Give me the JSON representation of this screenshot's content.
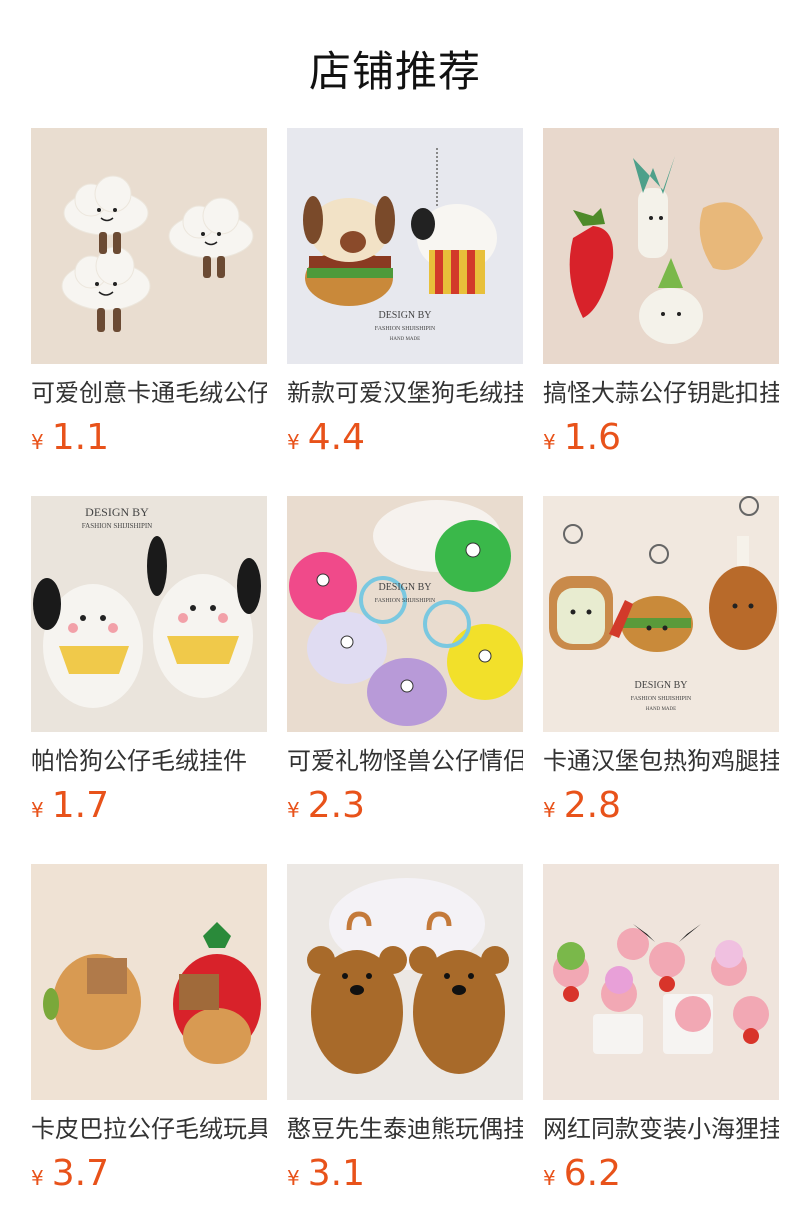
{
  "header": {
    "title": "店铺推荐"
  },
  "currency_symbol": "¥",
  "products": [
    {
      "name": "可爱创意卡通毛绒公仔",
      "price": "1.1",
      "image": "white-cloud-plush"
    },
    {
      "name": "新款可爱汉堡狗毛绒挂件",
      "price": "4.4",
      "image": "hamburger-dog-plush"
    },
    {
      "name": "搞怪大蒜公仔钥匙扣挂件",
      "price": "1.6",
      "image": "vegetable-plush"
    },
    {
      "name": "帕恰狗公仔毛绒挂件",
      "price": "1.7",
      "image": "pochacco-plush"
    },
    {
      "name": "可爱礼物怪兽公仔情侣",
      "price": "2.3",
      "image": "monster-plush"
    },
    {
      "name": "卡通汉堡包热狗鸡腿挂件",
      "price": "2.8",
      "image": "food-plush"
    },
    {
      "name": "卡皮巴拉公仔毛绒玩具",
      "price": "3.7",
      "image": "capybara-plush"
    },
    {
      "name": "憨豆先生泰迪熊玩偶挂件",
      "price": "3.1",
      "image": "teddy-bear-plush"
    },
    {
      "name": "网红同款变装小海狸挂件",
      "price": "6.2",
      "image": "loopy-beaver-plush"
    }
  ],
  "watermark": {
    "line1": "DESIGN BY",
    "line2": "FASHION SHIJISHIPIN",
    "line3": "HAND MADE"
  }
}
